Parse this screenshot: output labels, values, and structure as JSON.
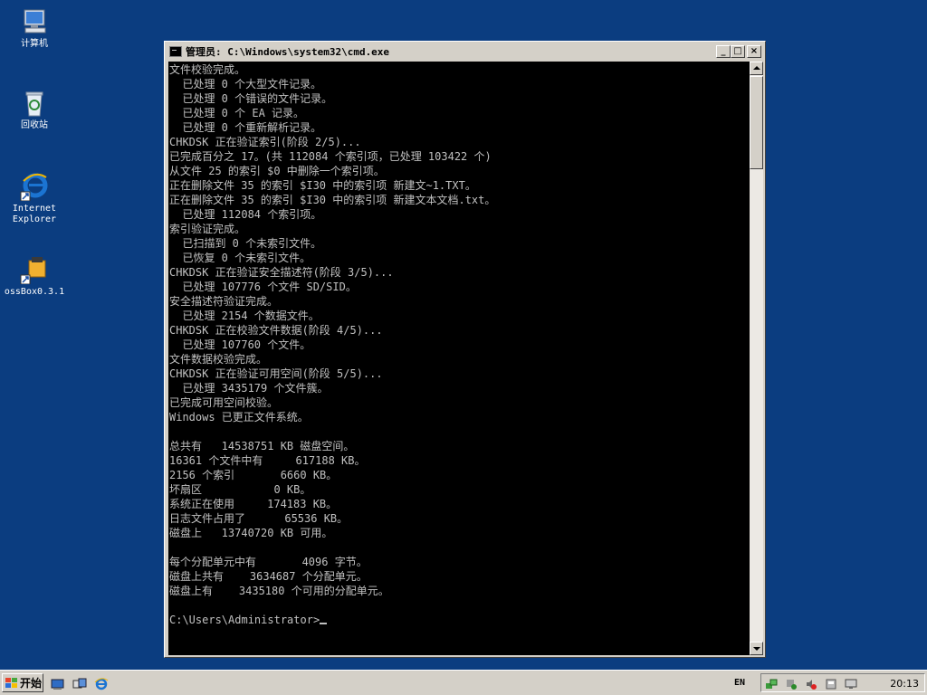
{
  "desktop": {
    "icons": [
      {
        "label": "计算机",
        "icon": "computer-icon"
      },
      {
        "label": "回收站",
        "icon": "recycle-bin-icon"
      },
      {
        "label_line1": "Internet",
        "label_line2": "Explorer",
        "icon": "internet-explorer-icon"
      },
      {
        "label": "ossBox0.3.1",
        "icon": "ossbox-icon"
      }
    ]
  },
  "window": {
    "title": "管理员: C:\\Windows\\system32\\cmd.exe",
    "buttons": {
      "minimize": "_",
      "maximize": "□",
      "close": "×"
    },
    "console_lines": [
      "文件校验完成。",
      "  已处理 0 个大型文件记录。",
      "  已处理 0 个错误的文件记录。",
      "  已处理 0 个 EA 记录。",
      "  已处理 0 个重新解析记录。",
      "CHKDSK 正在验证索引(阶段 2/5)...",
      "已完成百分之 17。(共 112084 个索引项，已处理 103422 个)",
      "从文件 25 的索引 $0 中删除一个索引项。",
      "正在删除文件 35 的索引 $I30 中的索引项 新建文~1.TXT。",
      "正在删除文件 35 的索引 $I30 中的索引项 新建文本文档.txt。",
      "  已处理 112084 个索引项。",
      "索引验证完成。",
      "  已扫描到 0 个未索引文件。",
      "  已恢复 0 个未索引文件。",
      "CHKDSK 正在验证安全描述符(阶段 3/5)...",
      "  已处理 107776 个文件 SD/SID。",
      "安全描述符验证完成。",
      "  已处理 2154 个数据文件。",
      "CHKDSK 正在校验文件数据(阶段 4/5)...",
      "  已处理 107760 个文件。",
      "文件数据校验完成。",
      "CHKDSK 正在验证可用空间(阶段 5/5)...",
      "  已处理 3435179 个文件簇。",
      "已完成可用空间校验。",
      "Windows 已更正文件系统。",
      "",
      "总共有   14538751 KB 磁盘空间。",
      "16361 个文件中有     617188 KB。",
      "2156 个索引       6660 KB。",
      "坏扇区           0 KB。",
      "系统正在使用     174183 KB。",
      "日志文件占用了      65536 KB。",
      "磁盘上   13740720 KB 可用。",
      "",
      "每个分配单元中有       4096 字节。",
      "磁盘上共有    3634687 个分配单元。",
      "磁盘上有    3435180 个可用的分配单元。",
      "",
      "C:\\Users\\Administrator>"
    ]
  },
  "taskbar": {
    "start_label": "开始",
    "quick_launch": [
      "server-manager-icon",
      "show-desktop-icon",
      "internet-explorer-icon"
    ],
    "tray": {
      "language": "EN",
      "icons": [
        "network-icon",
        "security-icon",
        "volume-muted-icon",
        "device-icon",
        "monitor-icon"
      ],
      "clock": "20:13"
    }
  },
  "colors": {
    "desktop": "#0b3d80",
    "console_bg": "#000000",
    "console_fg": "#c0c0c0",
    "chrome": "#d4d0c8"
  }
}
